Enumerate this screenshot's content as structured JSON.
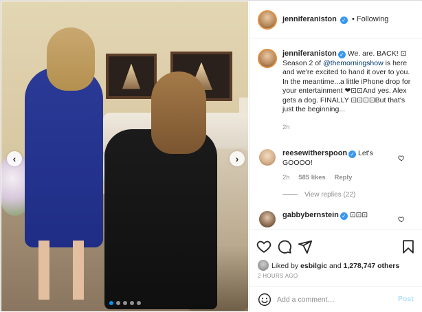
{
  "post": {
    "author": "jenniferaniston",
    "follow_separator": "•",
    "follow_state": "Following",
    "caption_author": "jenniferaniston",
    "caption_part1": " We. are. BACK! ",
    "caption_glyph1": "⊡",
    "caption_part2": " Season 2 of ",
    "caption_mention": "@themorningshow",
    "caption_part3": " is here and we're excited to hand it over to you. In the meantime...a little iPhone drop for your entertainment ",
    "caption_glyph2": "❤⊡⊡",
    "caption_part4": "And yes. Alex gets a dog. FINALLY ",
    "caption_glyph3": "⊡⊡⊡⊡",
    "caption_part5": "But that's just the beginning...",
    "caption_time": "2h"
  },
  "comments": [
    {
      "username": "reesewitherspoon",
      "text": " Let's GOOOO!",
      "time": "2h",
      "likes": "585 likes",
      "reply_label": "Reply",
      "view_replies": "View replies (22)"
    },
    {
      "username": "gabbybernstein",
      "text": " ⊡⊡⊡"
    }
  ],
  "actions": {
    "liked_by_prefix": "Liked by ",
    "liked_by_user": "esbilgic",
    "liked_by_conj": " and ",
    "liked_by_count": "1,278,747 others",
    "timestamp": "2 HOURS AGO"
  },
  "composer": {
    "placeholder": "Add a comment…",
    "post_label": "Post"
  },
  "carousel": {
    "prev_glyph": "‹",
    "next_glyph": "›",
    "dot_count": 5,
    "active_index": 0
  },
  "icons": {
    "like": "heart-icon",
    "comment": "comment-icon",
    "share": "share-icon",
    "save": "bookmark-icon",
    "emoji": "emoji-icon"
  },
  "colors": {
    "verified": "#3897f0",
    "link": "#00376b",
    "muted": "#8e8e8e",
    "carousel_active": "#0095f6"
  }
}
